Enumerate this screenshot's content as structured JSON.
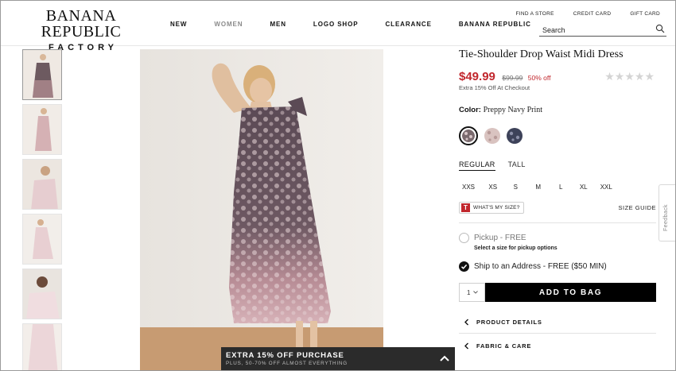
{
  "brand": {
    "line1": "BANANA REPUBLIC",
    "line2": "FACTORY"
  },
  "nav": {
    "items": [
      "NEW",
      "WOMEN",
      "MEN",
      "LOGO SHOP",
      "CLEARANCE",
      "BANANA REPUBLIC"
    ],
    "active": "WOMEN"
  },
  "utility": {
    "find_store": "FIND A STORE",
    "credit_card": "CREDIT CARD",
    "gift_card": "GIFT CARD"
  },
  "search": {
    "placeholder": "Search"
  },
  "product": {
    "title": "Tie-Shoulder Drop Waist Midi Dress",
    "sale_price": "$49.99",
    "original_price": "$99.99",
    "discount": "50% off",
    "extra": "Extra 15% Off At Checkout",
    "rating_stars": 5,
    "color_label": "Color:",
    "color_name": "Preppy Navy Print",
    "swatches": [
      {
        "name": "preppy-navy-print",
        "color": "#7a6a6e",
        "selected": true
      },
      {
        "name": "pink-print",
        "color": "#d9c3c0",
        "selected": false
      },
      {
        "name": "navy-print",
        "color": "#3d4259",
        "selected": false
      }
    ],
    "fit_tabs": [
      "REGULAR",
      "TALL"
    ],
    "fit_active": "REGULAR",
    "sizes": [
      "XXS",
      "XS",
      "S",
      "M",
      "L",
      "XL",
      "XXL"
    ],
    "whats_my_size_badge": "T",
    "whats_my_size": "WHAT'S MY SIZE?",
    "size_guide": "SIZE GUIDE",
    "pickup_label": "Pickup - FREE",
    "pickup_note": "Select a size for pickup options",
    "ship_label": "Ship to an Address - FREE ($50 MIN)",
    "quantity": "1",
    "add_to_bag": "ADD TO BAG",
    "accordion": [
      "PRODUCT DETAILS",
      "FABRIC & CARE"
    ]
  },
  "promo": {
    "title": "EXTRA 15% OFF PURCHASE",
    "subtitle": "PLUS, 50-70% OFF ALMOST EVERYTHING"
  },
  "feedback": {
    "label": "Feedback"
  },
  "colors": {
    "sale_red": "#c1272d",
    "black": "#000000",
    "promo_bg": "#2b2b2b"
  }
}
